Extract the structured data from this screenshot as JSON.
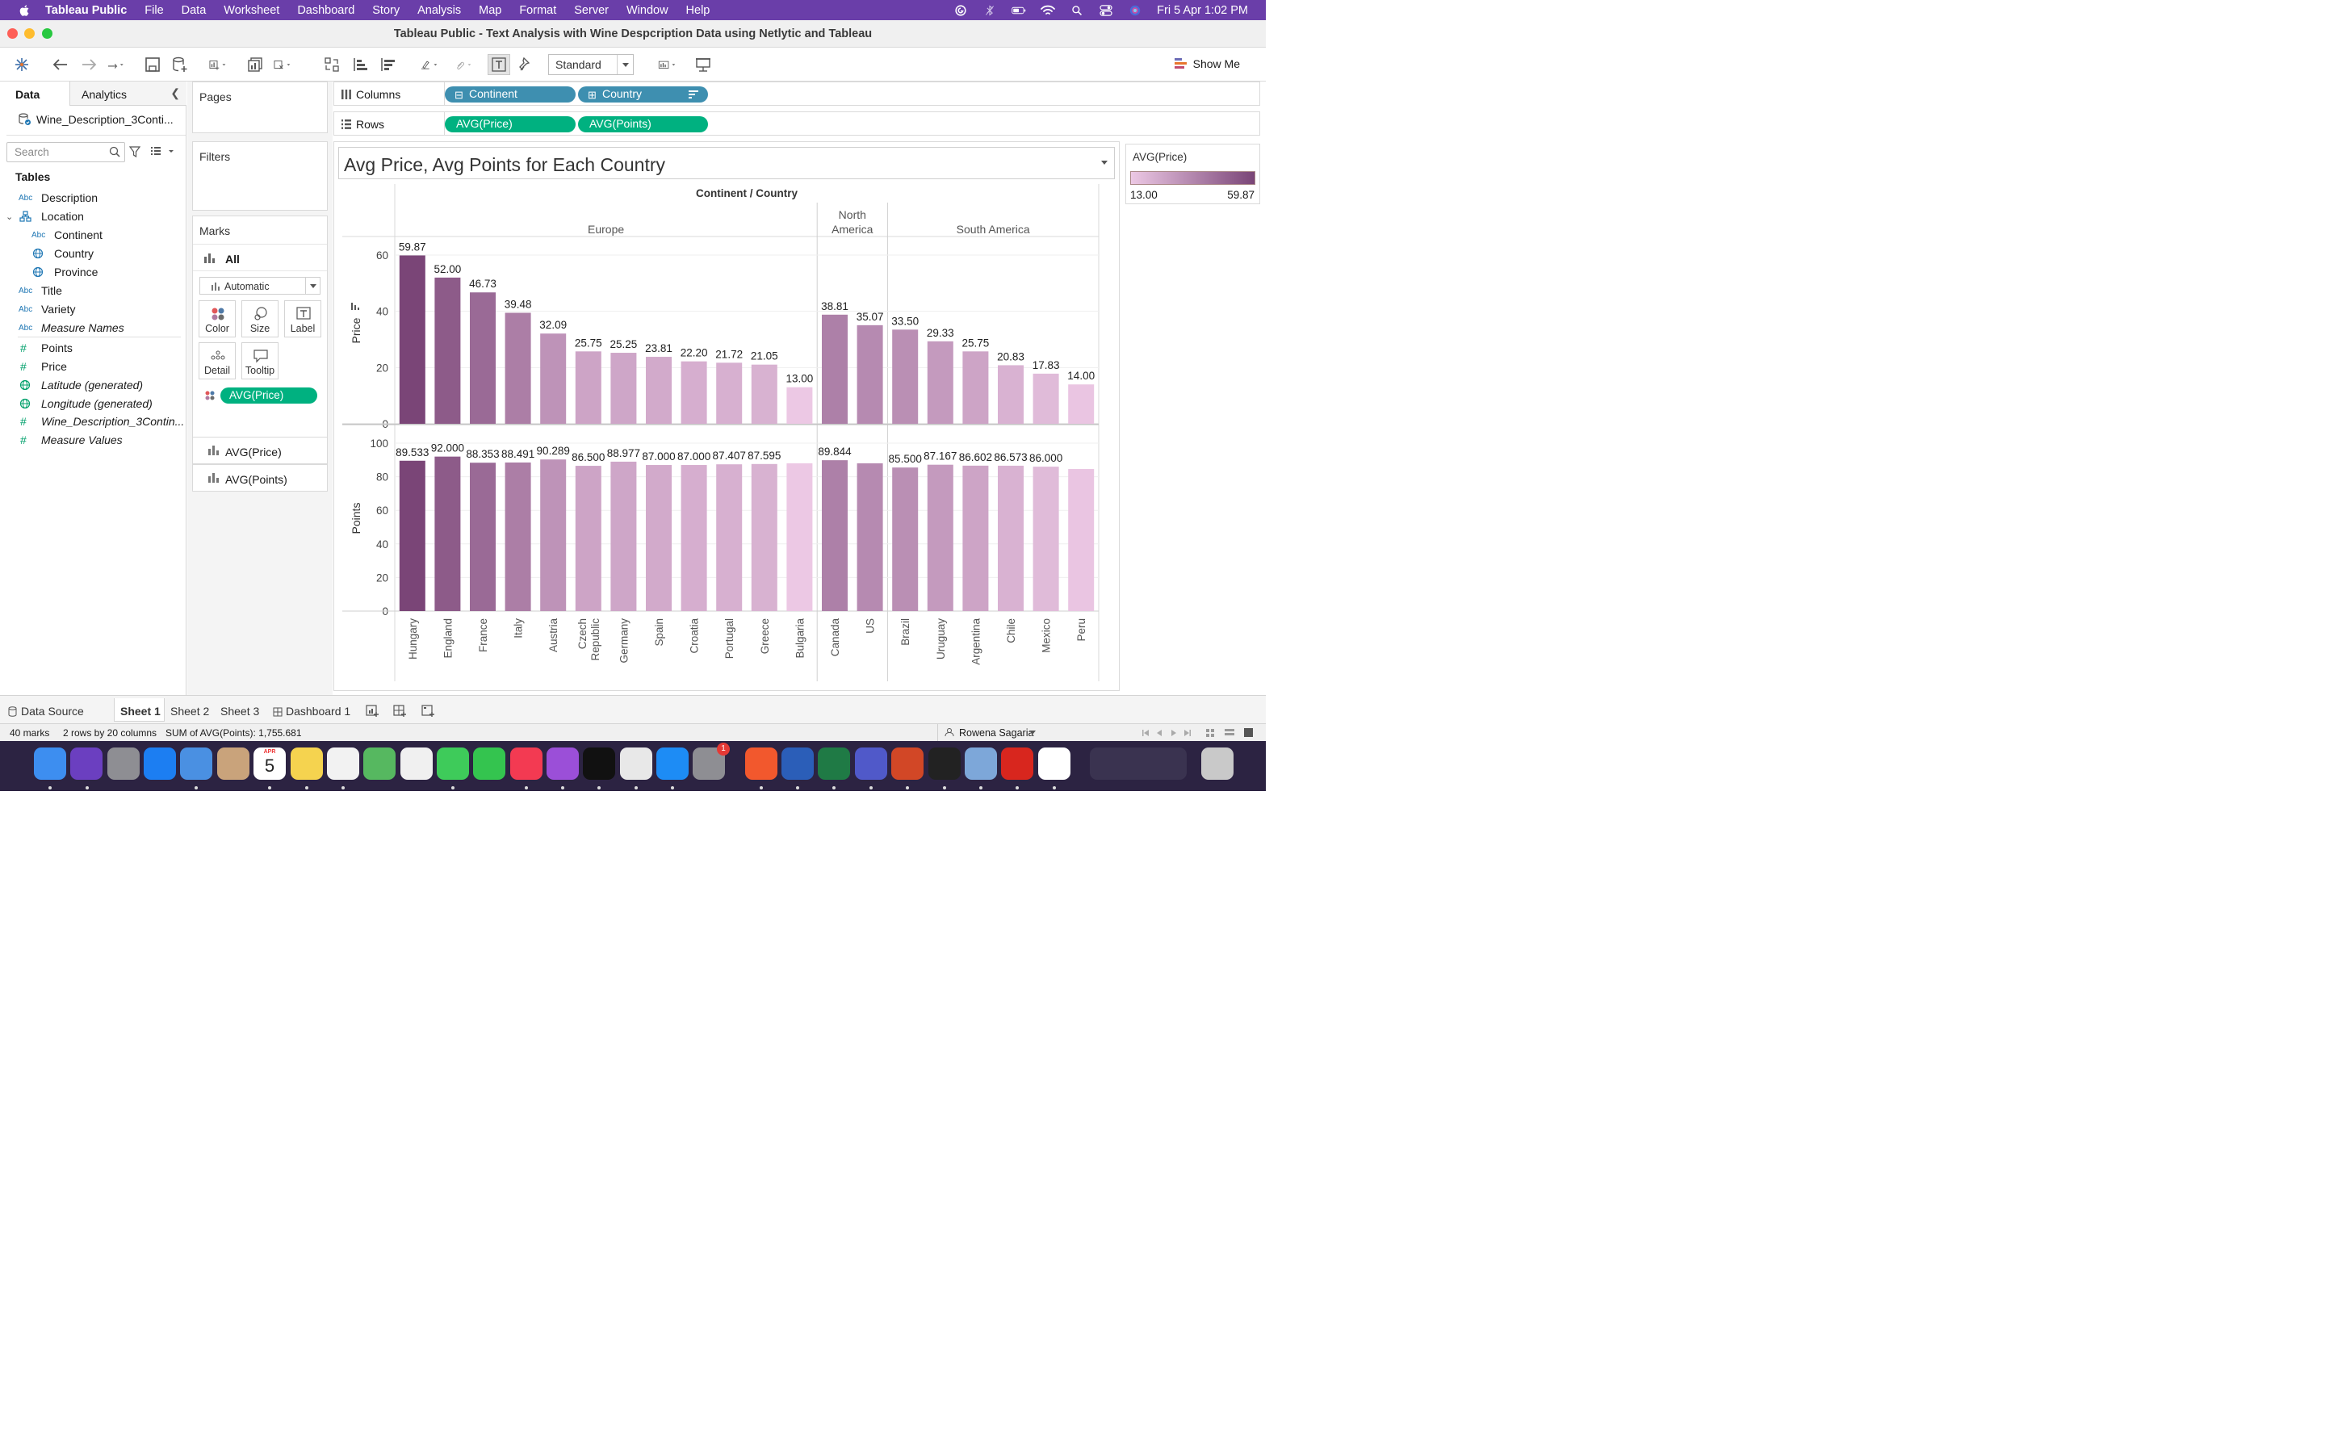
{
  "menubar": {
    "app_name": "Tableau Public",
    "items": [
      "File",
      "Data",
      "Worksheet",
      "Dashboard",
      "Story",
      "Analysis",
      "Map",
      "Format",
      "Server",
      "Window",
      "Help"
    ],
    "datetime": "Fri 5 Apr  1:02 PM"
  },
  "window": {
    "title": "Tableau Public - Text Analysis with Wine Despcription Data using Netlytic and Tableau"
  },
  "toolbar": {
    "fit": "Standard",
    "show_me": "Show Me"
  },
  "data_pane": {
    "tab_data": "Data",
    "tab_analytics": "Analytics",
    "datasource": "Wine_Description_3Conti...",
    "search_placeholder": "Search",
    "tables_header": "Tables",
    "fields": [
      {
        "name": "Description",
        "type": "Abc",
        "italic": false,
        "indent": 0
      },
      {
        "name": "Location",
        "type": "hier",
        "italic": false,
        "indent": 0
      },
      {
        "name": "Continent",
        "type": "Abc",
        "italic": false,
        "indent": 1
      },
      {
        "name": "Country",
        "type": "globe",
        "italic": false,
        "indent": 1
      },
      {
        "name": "Province",
        "type": "globe",
        "italic": false,
        "indent": 1
      },
      {
        "name": "Title",
        "type": "Abc",
        "italic": false,
        "indent": 0
      },
      {
        "name": "Variety",
        "type": "Abc",
        "italic": false,
        "indent": 0
      },
      {
        "name": "Measure Names",
        "type": "Abc",
        "italic": true,
        "indent": 0
      },
      {
        "name": "Points",
        "type": "#",
        "italic": false,
        "indent": 0
      },
      {
        "name": "Price",
        "type": "#",
        "italic": false,
        "indent": 0
      },
      {
        "name": "Latitude (generated)",
        "type": "geo",
        "italic": true,
        "indent": 0
      },
      {
        "name": "Longitude (generated)",
        "type": "geo",
        "italic": true,
        "indent": 0
      },
      {
        "name": "Wine_Description_3Contin...",
        "type": "#",
        "italic": true,
        "indent": 0
      },
      {
        "name": "Measure Values",
        "type": "#",
        "italic": true,
        "indent": 0
      }
    ]
  },
  "cards": {
    "pages": "Pages",
    "filters": "Filters",
    "marks": "Marks",
    "marks_all": "All",
    "mark_type": "Automatic",
    "buttons": [
      "Color",
      "Size",
      "Label",
      "Detail",
      "Tooltip"
    ],
    "color_pill": "AVG(Price)",
    "measure_cards": [
      "AVG(Price)",
      "AVG(Points)"
    ]
  },
  "shelves": {
    "columns_label": "Columns",
    "rows_label": "Rows",
    "columns": [
      "Continent",
      "Country"
    ],
    "rows": [
      "AVG(Price)",
      "AVG(Points)"
    ]
  },
  "view": {
    "title": "Avg Price, Avg Points for Each Country",
    "header": "Continent / Country"
  },
  "legend": {
    "title": "AVG(Price)",
    "min": "13.00",
    "max": "59.87",
    "color_low": "#ecc8e4",
    "color_high": "#7a4577"
  },
  "chart_data": {
    "type": "bar",
    "title": "Avg Price, Avg Points for Each Country",
    "xlabel": "Continent / Country",
    "groups": [
      {
        "name": "Europe",
        "categories": [
          "Hungary",
          "England",
          "France",
          "Italy",
          "Austria",
          "Czech Republic",
          "Germany",
          "Spain",
          "Croatia",
          "Portugal",
          "Greece",
          "Bulgaria"
        ]
      },
      {
        "name": "North America",
        "categories": [
          "Canada",
          "US"
        ]
      },
      {
        "name": "South America",
        "categories": [
          "Brazil",
          "Uruguay",
          "Argentina",
          "Chile",
          "Mexico",
          "Peru"
        ]
      }
    ],
    "series": [
      {
        "name": "Price",
        "ylabel": "Price",
        "ylim": [
          0,
          60
        ],
        "ticks": [
          0,
          20,
          40,
          60
        ],
        "values": [
          59.87,
          52.0,
          46.73,
          39.48,
          32.09,
          25.75,
          25.25,
          23.81,
          22.2,
          21.72,
          21.05,
          13.0,
          38.81,
          35.07,
          33.5,
          29.33,
          25.75,
          20.83,
          17.83,
          14.0
        ],
        "labels": [
          "59.87",
          "52.00",
          "46.73",
          "39.48",
          "32.09",
          "25.75",
          "25.25",
          "23.81",
          "22.20",
          "21.72",
          "21.05",
          "13.00",
          "38.81",
          "35.07",
          "33.50",
          "29.33",
          "25.75",
          "20.83",
          "17.83",
          "14.00"
        ]
      },
      {
        "name": "Points",
        "ylabel": "Points",
        "ylim": [
          0,
          100
        ],
        "ticks": [
          0,
          20,
          40,
          60,
          80,
          100
        ],
        "values": [
          89.533,
          92.0,
          88.353,
          88.491,
          90.289,
          86.5,
          88.977,
          87.0,
          87.0,
          87.407,
          87.595,
          88.0,
          89.844,
          88.0,
          85.5,
          87.167,
          86.602,
          86.573,
          86.0,
          84.6
        ],
        "labels": [
          "89.533",
          "92.000",
          "88.353",
          "88.491",
          "90.289",
          "86.500",
          "88.977",
          "87.000",
          "87.000",
          "87.407",
          "87.595",
          "",
          "89.844",
          "",
          "85.500",
          "87.167",
          "86.602",
          "86.573",
          "86.000",
          ""
        ]
      }
    ],
    "color_by": "Price",
    "grid": true
  },
  "sheet_tabs": {
    "data_source": "Data Source",
    "sheets": [
      "Sheet 1",
      "Sheet 2",
      "Sheet 3"
    ],
    "dashboard": "Dashboard 1"
  },
  "status": {
    "marks": "40 marks",
    "dims": "2 rows by 20 columns",
    "sum": "SUM of AVG(Points): 1,755.681",
    "user": "Rowena Sagaria"
  },
  "dock": {
    "calendar_month": "APR",
    "calendar_day": "5",
    "settings_badge": "1"
  }
}
